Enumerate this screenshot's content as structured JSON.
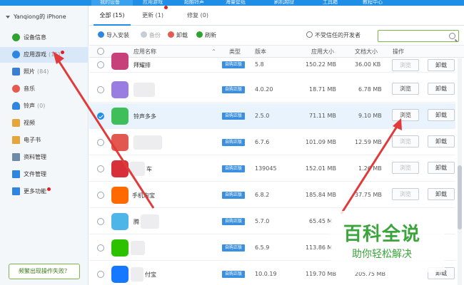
{
  "topbar": {
    "tabs": [
      "我的设备",
      "应用游戏",
      "超酷铃声",
      "海量壁纸",
      "刷机越狱",
      "工具箱",
      "教程中心"
    ]
  },
  "sidebar": {
    "device_title": "Yanqiong的 iPhone",
    "items": [
      {
        "label": "设备信息",
        "count": "",
        "icon": "info-icon",
        "color": "#2fa32f"
      },
      {
        "label": "应用游戏",
        "count": "(15)",
        "icon": "app-store-icon",
        "color": "#2f86e0",
        "dot": true
      },
      {
        "label": "照片",
        "count": "(84)",
        "icon": "photo-icon",
        "color": "#3b7fd2"
      },
      {
        "label": "音乐",
        "count": "",
        "icon": "music-icon",
        "color": "#e55a4e"
      },
      {
        "label": "铃声",
        "count": "(0)",
        "icon": "bell-icon",
        "color": "#2f86e0"
      },
      {
        "label": "视频",
        "count": "",
        "icon": "video-icon",
        "color": "#e4a53a"
      },
      {
        "label": "电子书",
        "count": "",
        "icon": "book-icon",
        "color": "#e4a53a"
      },
      {
        "label": "资料管理",
        "count": "",
        "icon": "contacts-icon",
        "color": "#6f8aa6"
      },
      {
        "label": "文件管理",
        "count": "",
        "icon": "folder-icon",
        "color": "#2f86e0"
      },
      {
        "label": "更多功能",
        "count": "",
        "icon": "more-icon",
        "color": "#2f86e0",
        "dot": true
      }
    ],
    "fail_button": "频繁出现操作失败？"
  },
  "tabs": {
    "all": "全部 (15)",
    "update": "更新 (1)",
    "repair": "修复 (0)"
  },
  "toolbar": {
    "import": "导入安装",
    "backup": "备份",
    "uninstall": "卸载",
    "refresh": "刷新",
    "untrusted": "不受信任的开发者"
  },
  "table": {
    "headers": {
      "name": "应用名称",
      "type": "类型",
      "version": "版本",
      "app_size": "应用大小",
      "doc_size": "文档大小",
      "action": "操作"
    },
    "rows": [
      {
        "name": "拜耀排",
        "type": "自购正版",
        "version": "5.8",
        "app_size": "150.22 MB",
        "doc_size": "36.00 KB",
        "icon_color": "#c8407a",
        "browse_disabled": true,
        "selected": false
      },
      {
        "name": "",
        "type": "自购正版",
        "version": "4.0.20",
        "app_size": "18.71 MB",
        "doc_size": "6.78 MB",
        "icon_color": "#9a7de0",
        "browse_disabled": false,
        "selected": false
      },
      {
        "name": "铃声多多",
        "type": "自购正版",
        "version": "2.5.0",
        "app_size": "71.11 MB",
        "doc_size": "9.10 MB",
        "icon_color": "#3fbf5a",
        "browse_disabled": false,
        "selected": true
      },
      {
        "name": "",
        "type": "自购正版",
        "version": "6.7.6",
        "app_size": "101.09 MB",
        "doc_size": "12.59 MB",
        "icon_color": "#e2574f",
        "browse_disabled": true,
        "selected": false
      },
      {
        "name": "车",
        "type": "自购正版",
        "version": "139045",
        "app_size": "152.01 MB",
        "doc_size": "1.26 MB",
        "icon_color": "#d8303a",
        "browse_disabled": true,
        "selected": false
      },
      {
        "name": "手机淘宝",
        "type": "自购正版",
        "version": "6.8.2",
        "app_size": "185.84 MB",
        "doc_size": "37.75 MB",
        "icon_color": "#ff6a00",
        "browse_disabled": true,
        "selected": false
      },
      {
        "name": "腾",
        "type": "自购正版",
        "version": "5.7.0",
        "app_size": "65.45 M",
        "doc_size": "",
        "icon_color": "#4db5e8",
        "browse_disabled": true,
        "selected": false
      },
      {
        "name": "",
        "type": "自购正版",
        "version": "6.5.9",
        "app_size": "113.86 M",
        "doc_size": "",
        "icon_color": "#2dc100",
        "browse_disabled": true,
        "selected": false
      },
      {
        "name": "付宝",
        "type": "自购正版",
        "version": "10.0.19",
        "app_size": "119.70 MB",
        "doc_size": "205.75 MB",
        "icon_color": "#1678ff",
        "browse_disabled": true,
        "selected": false
      }
    ],
    "browse_label": "浏览",
    "uninstall_label": "卸载"
  },
  "watermark": {
    "line1": "百科全说",
    "line2": "助你轻松解决"
  },
  "colors": {
    "accent": "#1f8ee6",
    "arrow": "#e03a3a",
    "badge": "#3b8fe0",
    "watermark": "#3aa53a"
  }
}
